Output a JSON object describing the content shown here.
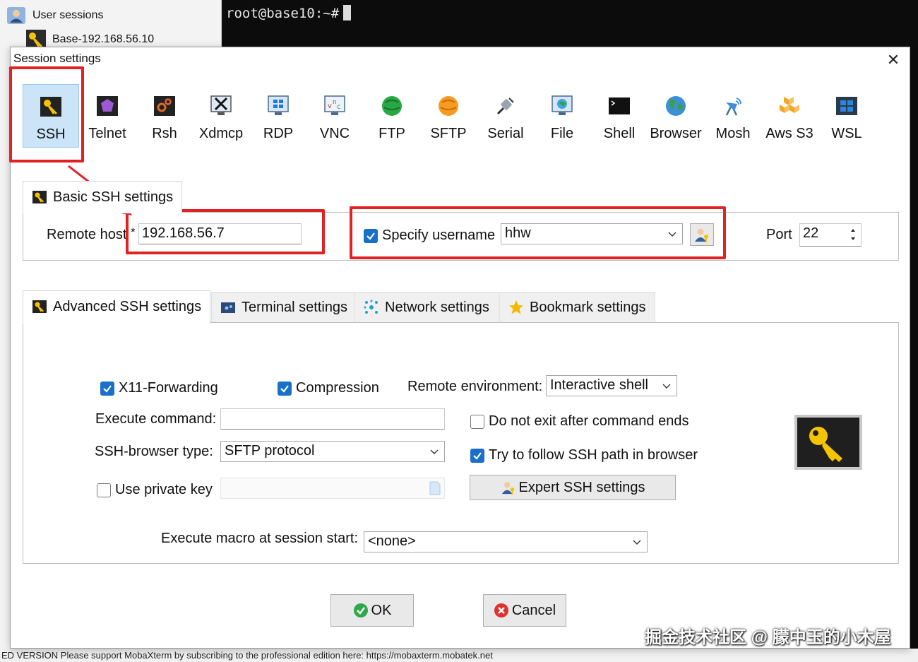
{
  "background": {
    "sessions_header": "User sessions",
    "session_item": "Base-192.168.56.10",
    "terminal_prompt": "root@base10:~#",
    "status_bar": "ED VERSION    Please support MobaXterm by subscribing to the professional edition here: https://mobaxterm.mobatek.net"
  },
  "dialog": {
    "title": "Session settings",
    "close_glyph": "✕"
  },
  "session_types": [
    {
      "label": "SSH",
      "icon": "key-icon"
    },
    {
      "label": "Telnet",
      "icon": "telnet-icon"
    },
    {
      "label": "Rsh",
      "icon": "rsh-icon"
    },
    {
      "label": "Xdmcp",
      "icon": "xdmcp-icon"
    },
    {
      "label": "RDP",
      "icon": "rdp-icon"
    },
    {
      "label": "VNC",
      "icon": "vnc-icon"
    },
    {
      "label": "FTP",
      "icon": "ftp-icon"
    },
    {
      "label": "SFTP",
      "icon": "sftp-icon"
    },
    {
      "label": "Serial",
      "icon": "serial-icon"
    },
    {
      "label": "File",
      "icon": "file-icon"
    },
    {
      "label": "Shell",
      "icon": "shell-icon"
    },
    {
      "label": "Browser",
      "icon": "browser-icon"
    },
    {
      "label": "Mosh",
      "icon": "mosh-icon"
    },
    {
      "label": "Aws S3",
      "icon": "aws-icon"
    },
    {
      "label": "WSL",
      "icon": "wsl-icon"
    }
  ],
  "selected_type": "SSH",
  "basic": {
    "tab_label": "Basic SSH settings",
    "remote_host_label": "Remote host",
    "required_mark": "*",
    "remote_host_value": "192.168.56.7",
    "specify_username_label": "Specify username",
    "specify_username_checked": true,
    "username_value": "hhw",
    "port_label": "Port",
    "port_value": "22"
  },
  "tabs": [
    {
      "label": "Advanced SSH settings",
      "icon": "key-icon",
      "active": true
    },
    {
      "label": "Terminal settings",
      "icon": "terminal-icon",
      "active": false
    },
    {
      "label": "Network settings",
      "icon": "network-icon",
      "active": false
    },
    {
      "label": "Bookmark settings",
      "icon": "star-icon",
      "active": false
    }
  ],
  "advanced": {
    "x11_label": "X11-Forwarding",
    "x11_checked": true,
    "compression_label": "Compression",
    "compression_checked": true,
    "remote_env_label": "Remote environment:",
    "remote_env_value": "Interactive shell",
    "execute_command_label": "Execute command:",
    "execute_command_value": "",
    "no_exit_label": "Do not exit after command ends",
    "no_exit_checked": false,
    "browser_type_label": "SSH-browser type:",
    "browser_type_value": "SFTP protocol",
    "follow_path_label": "Try to follow SSH path in browser",
    "follow_path_checked": true,
    "private_key_label": "Use private key",
    "private_key_checked": false,
    "expert_button": "Expert SSH settings",
    "macro_label": "Execute macro at session start:",
    "macro_value": "<none>"
  },
  "buttons": {
    "ok": "OK",
    "cancel": "Cancel"
  },
  "watermark": "掘金技术社区 @ 朦中玉的小木屋",
  "colors": {
    "accent": "#1a6fc9",
    "highlight": "#e22222",
    "selected_bg": "#cce4f7",
    "terminal_bg": "#0c0c0c"
  }
}
